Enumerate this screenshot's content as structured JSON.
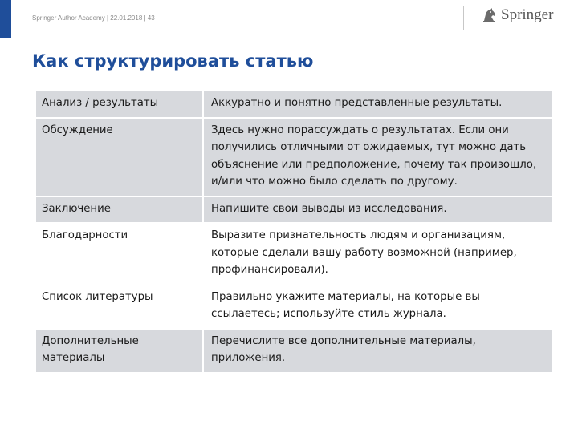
{
  "header": {
    "meta": "Springer Author Academy | 22.01.2018 | 43",
    "logo_text": "Springer"
  },
  "title": "Как структурировать статью",
  "colors": {
    "brand_blue": "#1f4e9a",
    "row_shade": "#d7d9dd"
  },
  "rows": [
    {
      "section": "Анализ / результаты",
      "description": "Аккуратно и понятно представленные результаты."
    },
    {
      "section": "Обсуждение",
      "description": "Здесь нужно порассуждать о результатах. Если они получились отличными от ожидаемых, тут можно дать объяснение или предположение, почему так произошло, и/или что можно было сделать по другому."
    },
    {
      "section": "Заключение",
      "description": "Напишите свои выводы из исследования."
    },
    {
      "section": "Благодарности",
      "description": "Выразите признательность людям и организациям, которые сделали вашу работу возможной (например, профинансировали)."
    },
    {
      "section": "Список литературы",
      "description": "Правильно укажите материалы, на которые вы ссылаетесь; используйте стиль журнала."
    },
    {
      "section": "Дополнительные материалы",
      "description": "Перечислите все дополнительные материалы, приложения."
    }
  ]
}
